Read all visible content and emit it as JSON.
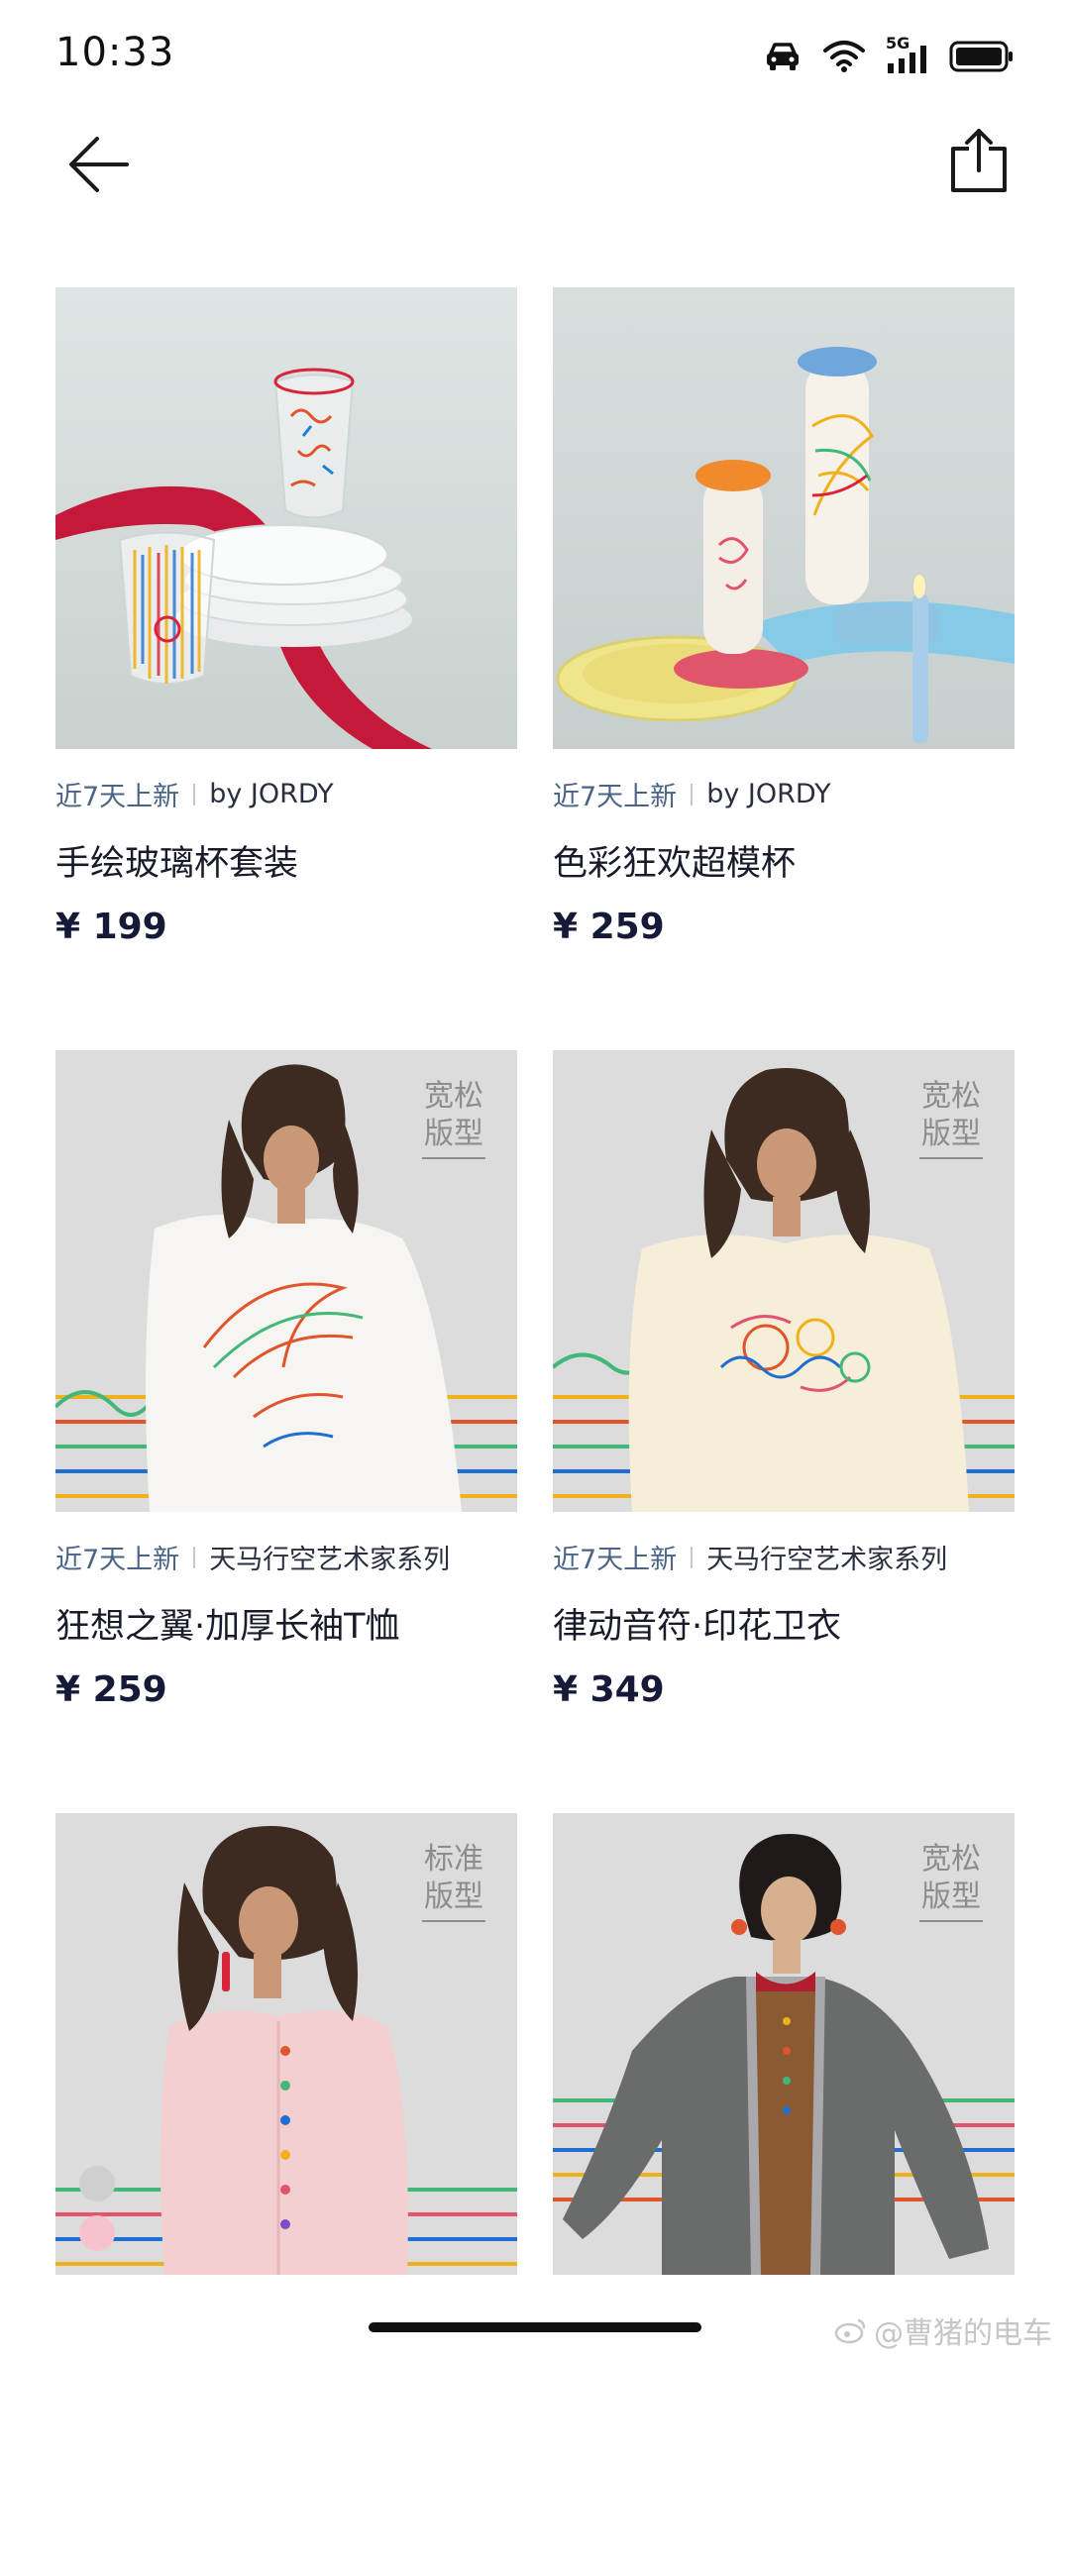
{
  "status_bar": {
    "time": "10:33",
    "network": "5G"
  },
  "nav": {
    "back_icon": "arrow-left-icon",
    "share_icon": "share-icon"
  },
  "products": [
    {
      "tag": "近7天上新",
      "brand": "by JORDY",
      "name": "手绘玻璃杯套装",
      "price": "¥ 199",
      "fit": "",
      "image": "glass-cups-set"
    },
    {
      "tag": "近7天上新",
      "brand": "by JORDY",
      "name": "色彩狂欢超模杯",
      "price": "¥ 259",
      "fit": "",
      "image": "color-bottles"
    },
    {
      "tag": "近7天上新",
      "brand": "天马行空艺术家系列",
      "name": "狂想之翼·加厚长袖T恤",
      "price": "¥ 259",
      "fit": "宽松版型",
      "image": "white-wing-tee"
    },
    {
      "tag": "近7天上新",
      "brand": "天马行空艺术家系列",
      "name": "律动音符·印花卫衣",
      "price": "¥ 349",
      "fit": "宽松版型",
      "image": "cream-sweatshirt"
    },
    {
      "tag": "",
      "brand": "",
      "name": "",
      "price": "",
      "fit": "标准版型",
      "image": "pink-cardigan"
    },
    {
      "tag": "",
      "brand": "",
      "name": "",
      "price": "",
      "fit": "宽松版型",
      "image": "grey-blazer"
    }
  ],
  "swatch_colors": [
    "#cfcfcf",
    "#f6c3cc"
  ],
  "watermark": "@曹猪的电车"
}
